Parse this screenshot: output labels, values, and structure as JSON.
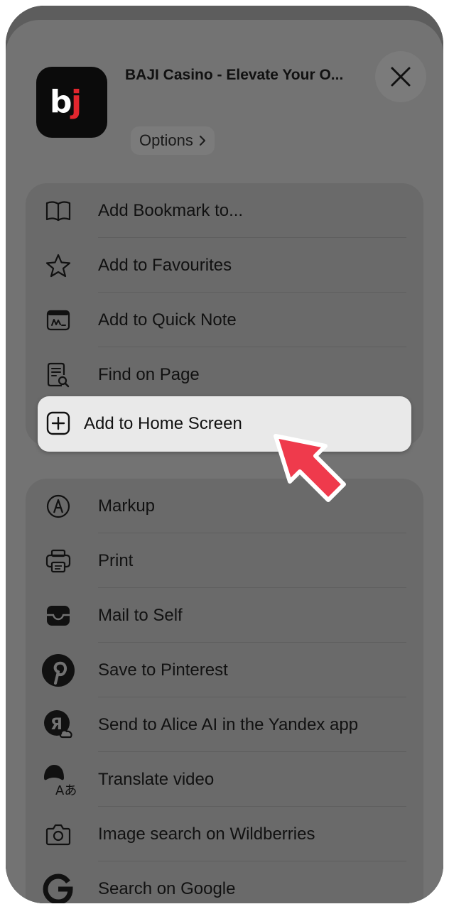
{
  "app": {
    "icon_text": "bj",
    "title": "BAJI Casino - Elevate Your O...",
    "options_label": "Options"
  },
  "menu_group_1": [
    {
      "label": "Add Bookmark to...",
      "icon": "book-icon"
    },
    {
      "label": "Add to Favourites",
      "icon": "star-icon"
    },
    {
      "label": "Add to Quick Note",
      "icon": "quick-note-icon"
    },
    {
      "label": "Find on Page",
      "icon": "find-on-page-icon"
    }
  ],
  "highlighted_item": {
    "label": "Add to Home Screen",
    "icon": "plus-square-icon"
  },
  "menu_group_2": [
    {
      "label": "Markup",
      "icon": "markup-pen-icon"
    },
    {
      "label": "Print",
      "icon": "printer-icon"
    },
    {
      "label": "Mail to Self",
      "icon": "mail-tray-icon"
    },
    {
      "label": "Save to Pinterest",
      "icon": "pinterest-icon"
    },
    {
      "label": "Send to Alice AI in the Yandex app",
      "icon": "yandex-alice-icon"
    },
    {
      "label": "Translate video",
      "icon": "translate-video-icon"
    },
    {
      "label": "Image search on Wildberries",
      "icon": "camera-icon"
    },
    {
      "label": "Search on Google",
      "icon": "google-icon"
    }
  ],
  "colors": {
    "brand_red": "#e2262e",
    "pointer_red": "#ef3a4c",
    "overlay": "#737373"
  }
}
